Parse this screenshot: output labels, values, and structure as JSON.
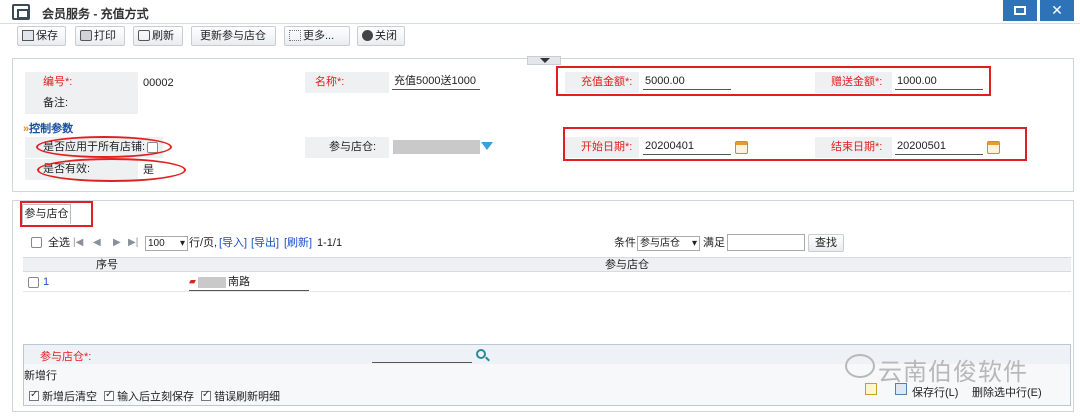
{
  "window": {
    "title": "会员服务 - 充值方式"
  },
  "toolbar": {
    "save": "保存",
    "print": "打印",
    "refresh": "刷新",
    "update_stores": "更新参与店仓",
    "more": "更多...",
    "close": "关闭"
  },
  "form": {
    "code_label": "编号*:",
    "code_value": "00002",
    "name_label": "名称*:",
    "name_value": "充值5000送1000",
    "recharge_label": "充值金额*:",
    "recharge_value": "5000.00",
    "bonus_label": "赠送金额*:",
    "bonus_value": "1000.00",
    "remark_label": "备注:",
    "section_title": "控制参数",
    "all_stores_label": "是否应用于所有店铺:",
    "stores_label": "参与店仓:",
    "start_label": "开始日期*:",
    "start_value": "20200401",
    "end_label": "结束日期*:",
    "end_value": "20200501",
    "valid_label": "是否有效:",
    "valid_value": "是"
  },
  "tab": {
    "label": "参与店仓"
  },
  "grid": {
    "select_all": "全选",
    "page_size": "100",
    "per_page": "行/页,",
    "import": "[导入]",
    "export": "[导出]",
    "refresh": "[刷新]",
    "range": "1-1/1",
    "condition_label": "条件",
    "condition_field": "参与店仓",
    "satisfy_label": "满足",
    "search_button": "查找",
    "columns": [
      "序号",
      "参与店仓"
    ],
    "rows": [
      {
        "index": "1",
        "store": "南路"
      }
    ]
  },
  "bottom": {
    "store_label": "参与店仓*:",
    "new_row": "新增行",
    "opt1": "新增后清空",
    "opt2": "输入后立刻保存",
    "opt3": "错误刷新明细",
    "save_row": "保存行(L)",
    "delete_row": "删除选中行(E)"
  },
  "watermark": "云南伯俊软件"
}
